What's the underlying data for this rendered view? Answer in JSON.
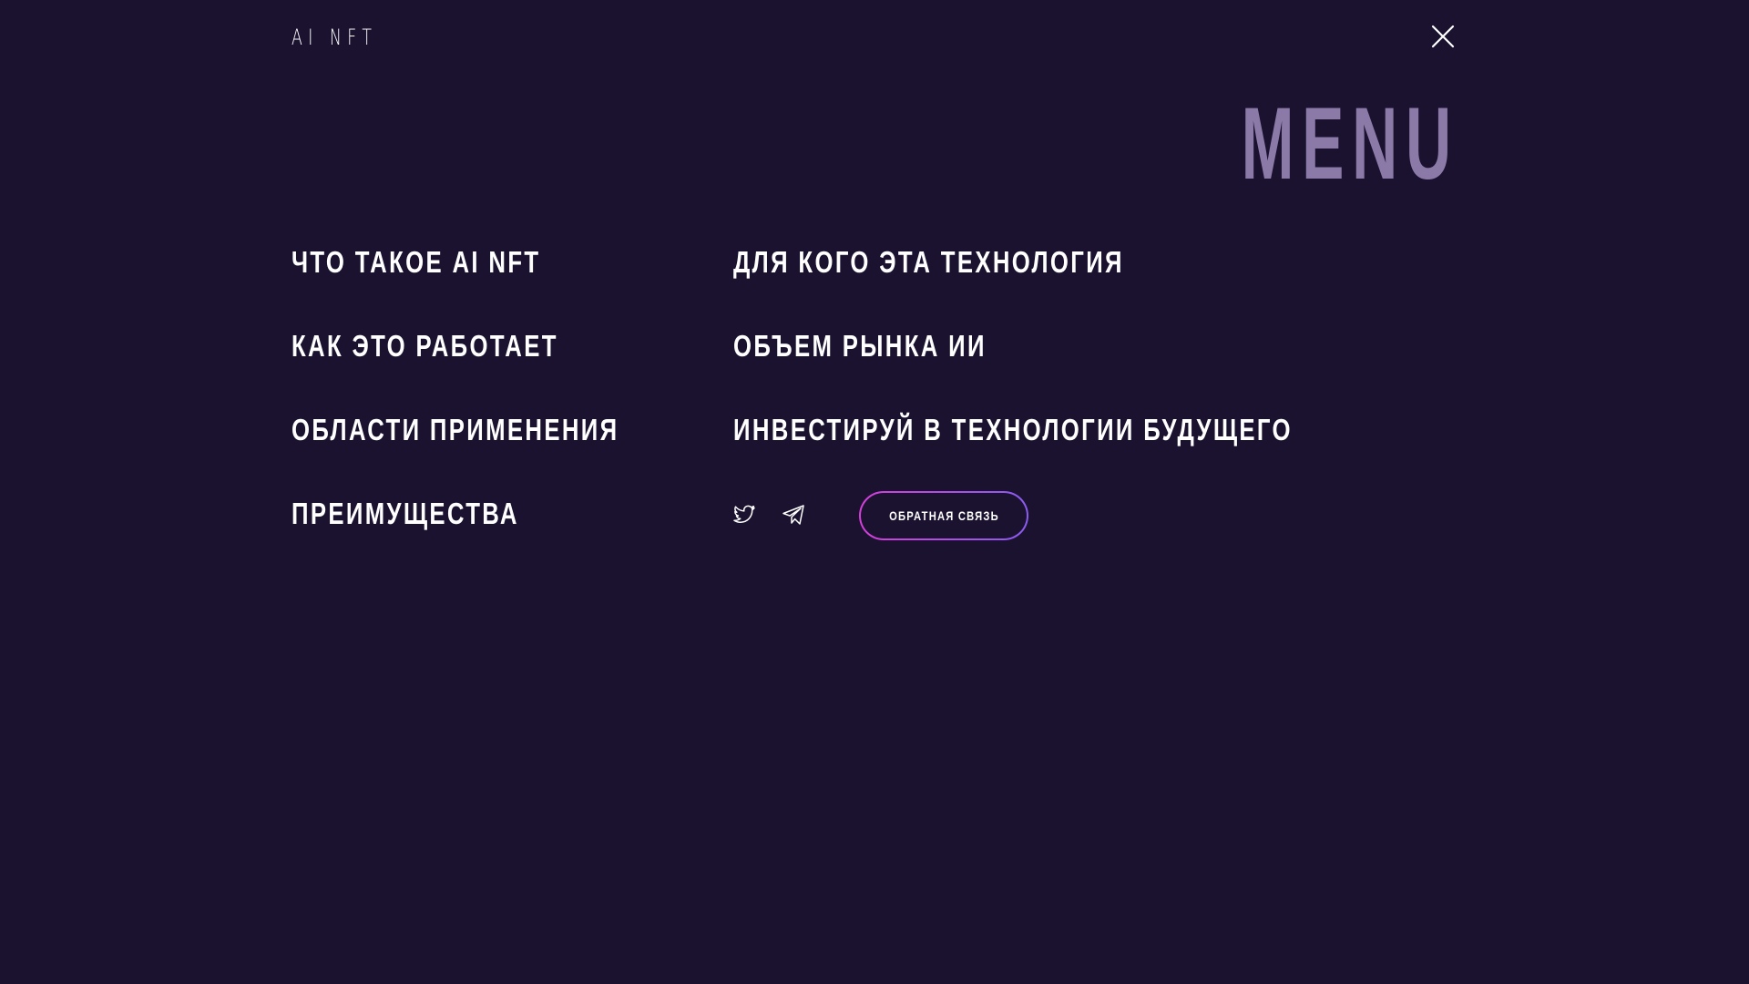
{
  "header": {
    "logo_text": "AI NFT",
    "close_icon": "close-icon"
  },
  "menu_title": "MENU",
  "nav": {
    "left": [
      {
        "label": "ЧТО ТАКОЕ AI NFT"
      },
      {
        "label": "КАК ЭТО РАБОТАЕТ"
      },
      {
        "label": "ОБЛАСТИ ПРИМЕНЕНИЯ"
      },
      {
        "label": "ПРЕИМУЩЕСТВА"
      }
    ],
    "right": [
      {
        "label": "ДЛЯ КОГО ЭТА ТЕХНОЛОГИЯ"
      },
      {
        "label": "ОБЪЕМ РЫНКА ИИ"
      },
      {
        "label": "ИНВЕСТИРУЙ В ТЕХНОЛОГИИ БУДУЩЕГО"
      }
    ]
  },
  "social": {
    "icons": [
      "twitter-icon",
      "telegram-icon"
    ]
  },
  "feedback_button": {
    "label": "ОБРАТНАЯ СВЯЗЬ"
  },
  "colors": {
    "background": "#1b1230",
    "menu_title": "#8b7aa8",
    "text": "#ffffff",
    "button_gradient_start": "#d43fd9",
    "button_gradient_end": "#8a5cf0"
  }
}
